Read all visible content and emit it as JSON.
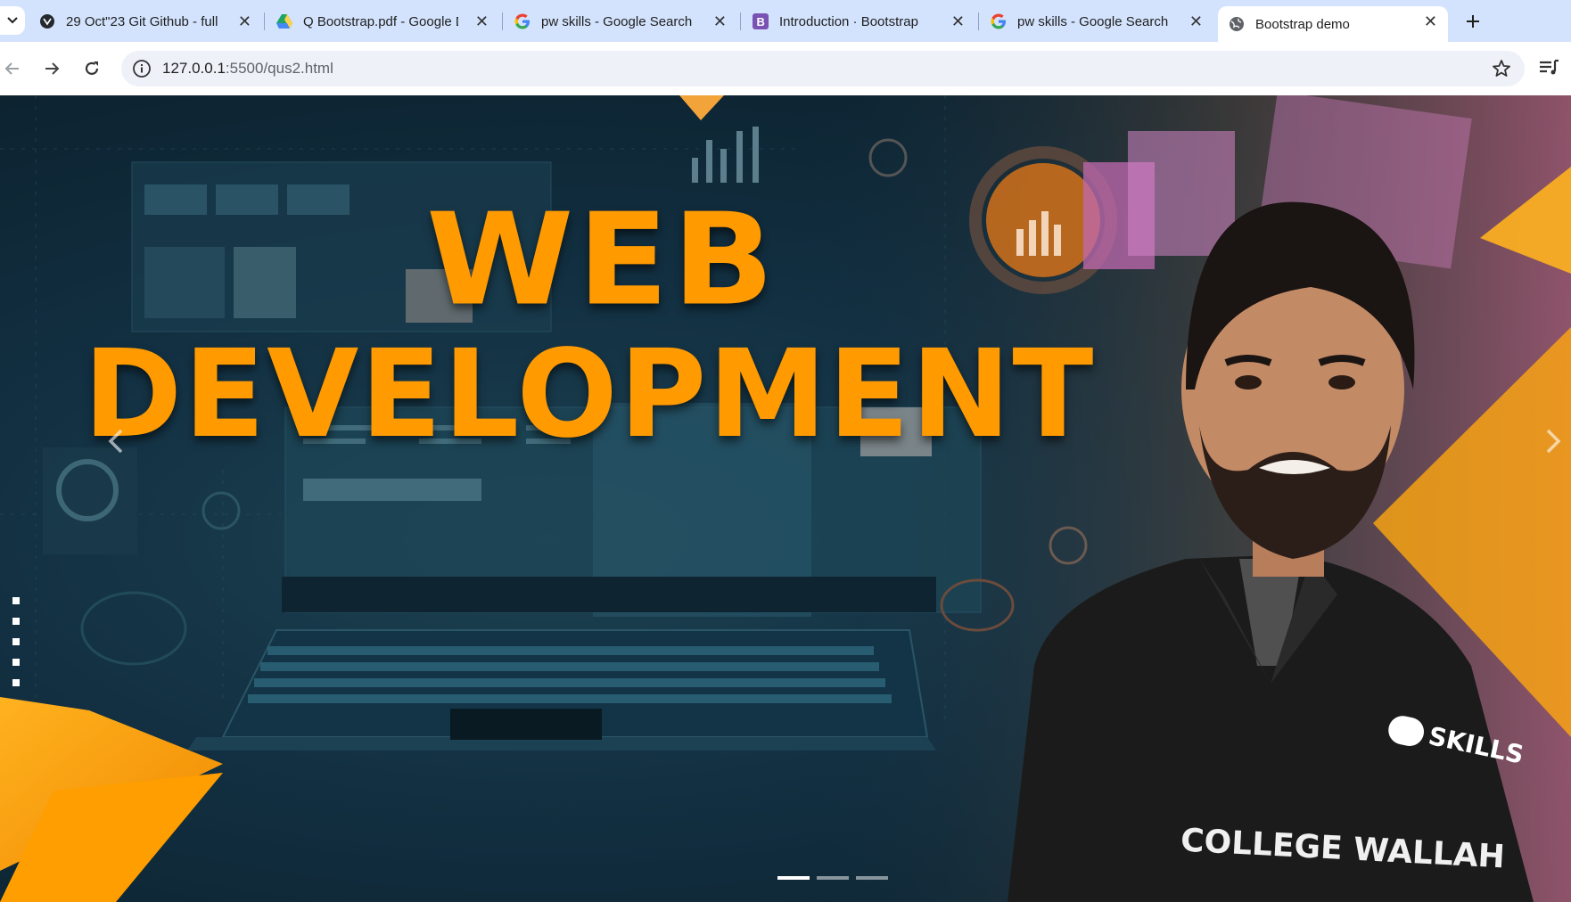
{
  "tabs": [
    {
      "title": "29 Oct\"23 Git Github - full",
      "icon": "github-icon"
    },
    {
      "title": "Q Bootstrap.pdf - Google D",
      "icon": "google-drive-icon"
    },
    {
      "title": "pw skills - Google Search",
      "icon": "google-icon"
    },
    {
      "title": "Introduction · Bootstrap",
      "icon": "bootstrap-icon"
    },
    {
      "title": "pw skills - Google Search",
      "icon": "google-icon"
    },
    {
      "title": "Bootstrap demo",
      "icon": "globe-icon",
      "active": true
    }
  ],
  "address_bar": {
    "host": "127.0.0.1",
    "rest": ":5500/qus2.html"
  },
  "hero": {
    "headline_line1": "WEB",
    "headline_line2": "DEVELOPMENT",
    "shirt_brand": "SKILLS",
    "shirt_text": "COLLEGE WALLAH",
    "slides_total": 3,
    "active_slide": 1
  },
  "colors": {
    "accent_orange": "#ff9a00",
    "tabstrip_bg": "#d3e3fd"
  }
}
